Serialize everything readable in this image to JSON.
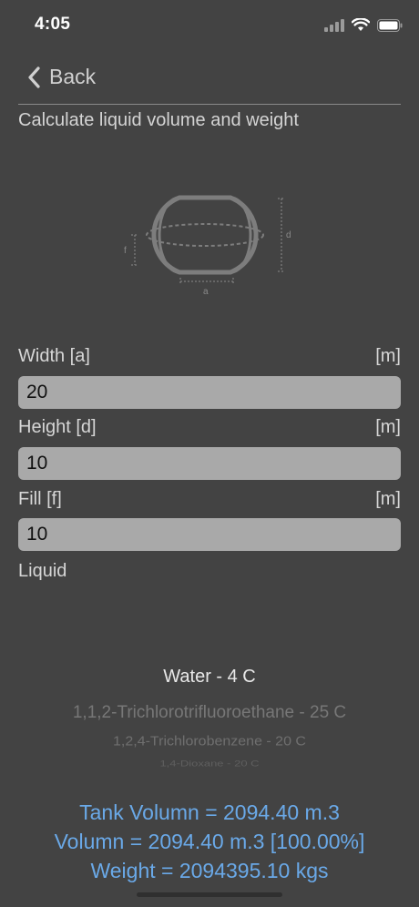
{
  "status": {
    "time": "4:05"
  },
  "nav": {
    "back_label": "Back"
  },
  "title": "Calculate liquid volume and weight",
  "diagram": {
    "label_a": "a",
    "label_d": "d",
    "label_f": "f"
  },
  "fields": [
    {
      "label": "Width [a]",
      "unit": "[m]",
      "value": "20"
    },
    {
      "label": "Height [d]",
      "unit": "[m]",
      "value": "10"
    },
    {
      "label": "Fill [f]",
      "unit": "[m]",
      "value": "10"
    }
  ],
  "liquid": {
    "label": "Liquid",
    "selected": "Water - 4 C",
    "options_below": [
      "1,1,2-Trichlorotrifluoroethane - 25 C",
      "1,2,4-Trichlorobenzene - 20 C",
      "1,4-Dioxane - 20 C"
    ]
  },
  "results": {
    "tank_volume": "Tank Volumn = 2094.40 m.3",
    "volume": "Volumn = 2094.40 m.3 [100.00%]",
    "weight": "Weight = 2094395.10 kgs"
  },
  "colors": {
    "background": "#434343",
    "accent": "#6aa9e8",
    "input_bg": "#a9a9a9"
  }
}
